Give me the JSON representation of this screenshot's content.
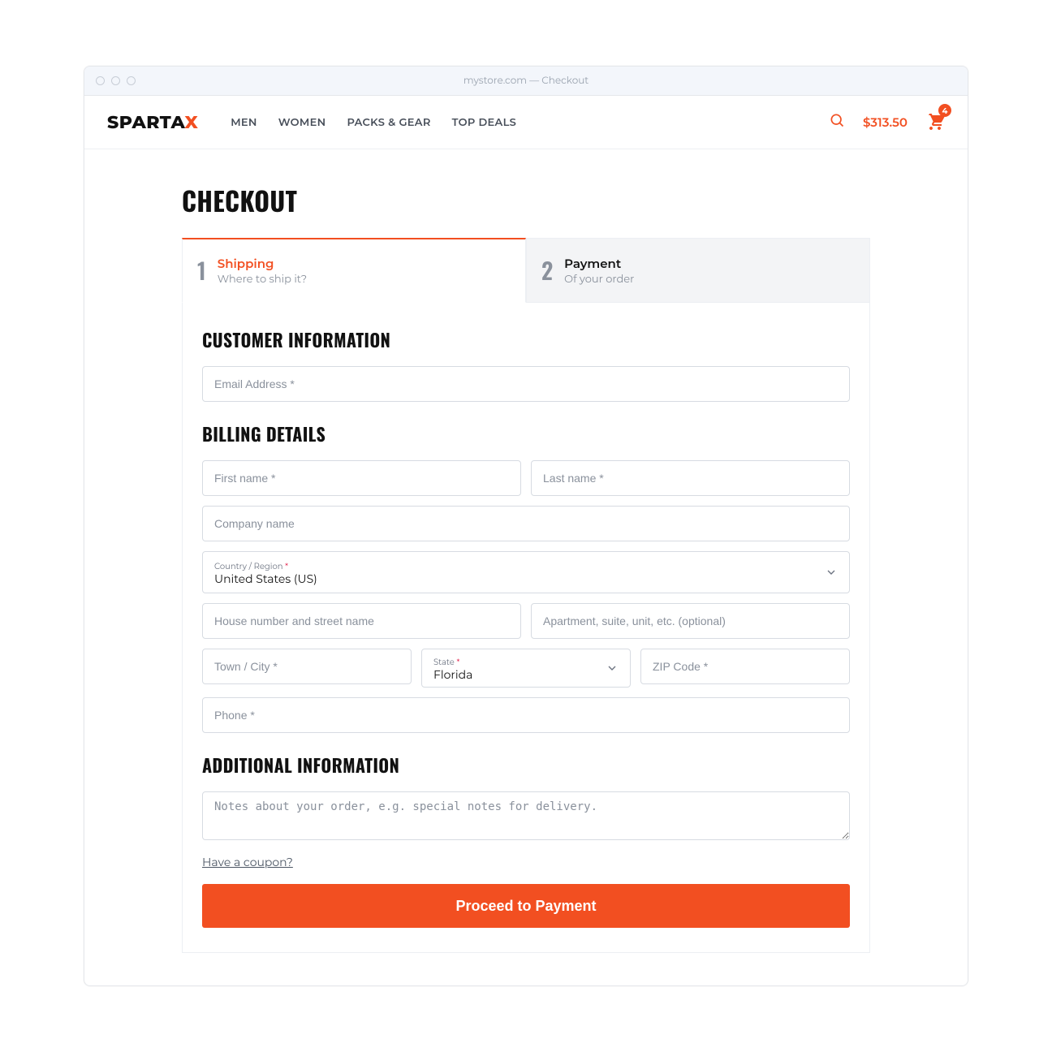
{
  "browser": {
    "title": "mystore.com — Checkout"
  },
  "header": {
    "logo_base": "SPARTA",
    "logo_accent": "X",
    "nav": [
      "MEN",
      "WOMEN",
      "PACKS & GEAR",
      "TOP DEALS"
    ],
    "cart_total": "$313.50",
    "cart_count": "4"
  },
  "page": {
    "title": "CHECKOUT"
  },
  "tabs": [
    {
      "num": "1",
      "title": "Shipping",
      "sub": "Where to ship it?"
    },
    {
      "num": "2",
      "title": "Payment",
      "sub": "Of your order"
    }
  ],
  "sections": {
    "customer": "CUSTOMER INFORMATION",
    "billing": "BILLING DETAILS",
    "additional": "ADDITIONAL INFORMATION"
  },
  "fields": {
    "email_ph": "Email Address *",
    "first_name_ph": "First name *",
    "last_name_ph": "Last name *",
    "company_ph": "Company name",
    "country_label": "Country / Region",
    "country_value": "United States (US)",
    "street_ph": "House number and street name",
    "apt_ph": "Apartment, suite, unit, etc. (optional)",
    "city_ph": "Town / City *",
    "state_label": "State",
    "state_value": "Florida",
    "zip_ph": "ZIP Code *",
    "phone_ph": "Phone *",
    "notes_ph": "Notes about your order, e.g. special notes for delivery."
  },
  "coupon_link": "Have a coupon?",
  "proceed_label": "Proceed to Payment",
  "required_mark": "*"
}
